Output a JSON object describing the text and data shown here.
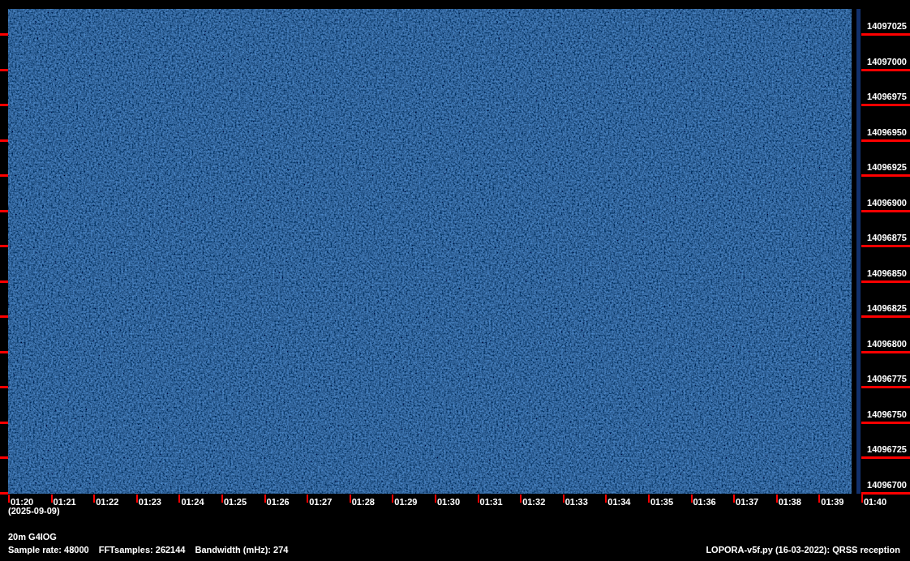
{
  "frequency_labels": [
    "14097025",
    "14097000",
    "14096975",
    "14096950",
    "14096925",
    "14096900",
    "14096875",
    "14096850",
    "14096825",
    "14096800",
    "14096775",
    "14096750",
    "14096725",
    "14096700"
  ],
  "time_labels": [
    "01:20",
    "01:21",
    "01:22",
    "01:23",
    "01:24",
    "01:25",
    "01:26",
    "01:27",
    "01:28",
    "01:29",
    "01:30",
    "01:31",
    "01:32",
    "01:33",
    "01:34",
    "01:35",
    "01:36",
    "01:37",
    "01:38",
    "01:39",
    "01:40"
  ],
  "date": "(2025-09-09)",
  "station": "20m G4IOG",
  "parameters": [
    "Sample rate: 48000",
    "FFTsamples: 262144",
    "Bandwidth (mHz): 274"
  ],
  "program": "LOPORA-v5f.py (16-03-2022): QRSS reception"
}
